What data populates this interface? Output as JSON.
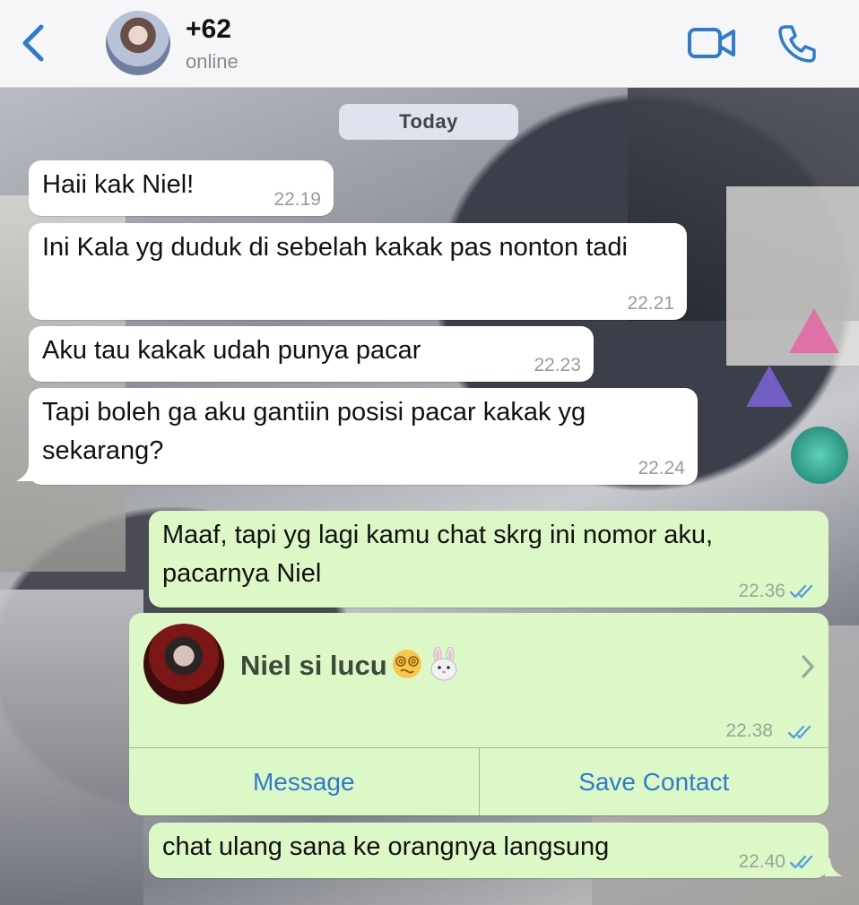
{
  "header": {
    "contact_name": "+62",
    "status": "online"
  },
  "date_separator": "Today",
  "messages": [
    {
      "direction": "incoming",
      "text": "Haii kak Niel!",
      "time": "22.19"
    },
    {
      "direction": "incoming",
      "text": "Ini Kala yg duduk di sebelah kakak pas nonton tadi",
      "time": "22.21"
    },
    {
      "direction": "incoming",
      "text": "Aku tau kakak udah punya pacar",
      "time": "22.23"
    },
    {
      "direction": "incoming",
      "text": "Tapi boleh ga aku gantiin posisi pacar kakak yg sekarang?",
      "time": "22.24"
    },
    {
      "direction": "outgoing",
      "text": "Maaf, tapi yg lagi kamu chat skrg ini nomor aku, pacarnya Niel",
      "time": "22.36",
      "status": "read"
    },
    {
      "direction": "outgoing",
      "text": "chat ulang sana ke orangnya langsung",
      "time": "22.40",
      "status": "read"
    }
  ],
  "contact_card": {
    "name": "Niel si lucu",
    "time": "22.38",
    "status": "read",
    "message_label": "Message",
    "save_label": "Save Contact"
  },
  "colors": {
    "accent": "#2f7bd0",
    "incoming_bubble": "#ffffff",
    "outgoing_bubble": "#dcf8c6",
    "read_ticks": "#5aa0e0"
  },
  "icons": [
    "chevron-left-icon",
    "video-call-icon",
    "phone-icon",
    "double-check-icon",
    "chevron-right-icon",
    "dizzy-face-emoji",
    "rabbit-emoji"
  ]
}
